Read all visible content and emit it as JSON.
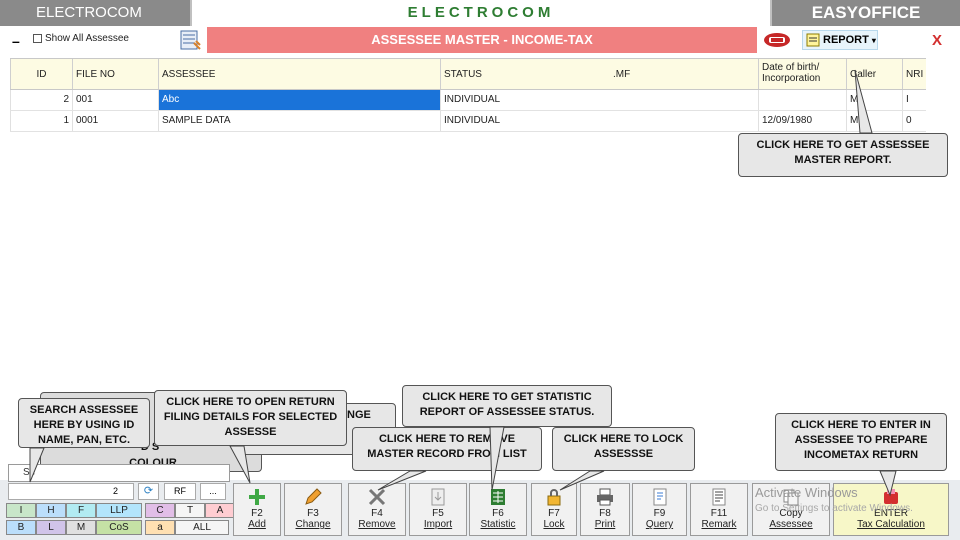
{
  "header": {
    "brand_left": "ELECTROCOM",
    "brand_center": "ELECTROCOM",
    "brand_right": "EASYOFFICE"
  },
  "toolbar": {
    "minimize_label": "–",
    "show_all_label": "Show All Assessee",
    "title": "ASSESSEE MASTER - INCOME-TAX",
    "report_label": "REPORT",
    "report_arrow": "▾",
    "close_label": "X"
  },
  "grid": {
    "columns": [
      "ID",
      "FILE NO",
      "ASSESSEE",
      "STATUS",
      ".MF",
      "Date of birth/ Incorporation",
      "Caller",
      "NRI"
    ],
    "rows": [
      {
        "id": "2",
        "file_no": "001",
        "assessee": "Abc",
        "status": "INDIVIDUAL",
        "mf": "",
        "dob": "",
        "caller": "M",
        "nri": "I"
      },
      {
        "id": "1",
        "file_no": "0001",
        "assessee": "SAMPLE DATA",
        "status": "INDIVIDUAL",
        "mf": "",
        "dob": "12/09/1980",
        "caller": "M",
        "nri": "0"
      }
    ]
  },
  "callouts": {
    "report": "CLICK HERE TO GET ASSESSEE MASTER REPORT.",
    "search": "SEARCH ASSESSEE HERE BY USING ID NAME, PAN, ETC.",
    "colour_fragment": "D S",
    "colour": "COLOUR",
    "open_return": "CLICK HERE TO OPEN RETURN FILING DETAILS FOR SELECTED ASSESSE",
    "change_fragment": "NGE",
    "statistic": "CLICK HERE TO GET STATISTIC REPORT OF ASSESSEE STATUS.",
    "remove": "CLICK HERE TO REMOVE MASTER RECORD FROM LIST",
    "lock": "CLICK HERE TO LOCK ASSESSSE",
    "enter": "CLICK HERE TO ENTER IN ASSESSEE TO PREPARE INCOMETAX RETURN"
  },
  "bottom": {
    "search_text": "Se",
    "filter_value": "2",
    "refresh_icon": "⟳",
    "rf_label": "RF",
    "dots_label": "...",
    "filter_rows": [
      [
        "I",
        "H",
        "F",
        "LLP",
        "C",
        "T",
        "A"
      ],
      [
        "B",
        "L",
        "M",
        "CoS",
        "a",
        "ALL"
      ]
    ],
    "fkeys": [
      {
        "key": "F2",
        "label": "Add"
      },
      {
        "key": "F3",
        "label": "Change"
      },
      {
        "key": "F4",
        "label": "Remove"
      },
      {
        "key": "F5",
        "label": "Import"
      },
      {
        "key": "F6",
        "label": "Statistic"
      },
      {
        "key": "F7",
        "label": "Lock"
      },
      {
        "key": "F8",
        "label": "Print"
      },
      {
        "key": "F9",
        "label": "Query"
      },
      {
        "key": "F11",
        "label": "Remark"
      },
      {
        "key": "Copy",
        "label": "Assessee"
      },
      {
        "key": "ENTER",
        "label": "Tax Calculation"
      }
    ],
    "watermark_title": "Activate Windows",
    "watermark_sub": "Go to Settings to activate Windows."
  },
  "colors": {
    "brand_green": "#2e7d32",
    "title_banner": "#f08080",
    "selection": "#1a73d9",
    "close_red": "#d32f2f",
    "enter_bg": "#f7f7c8"
  }
}
